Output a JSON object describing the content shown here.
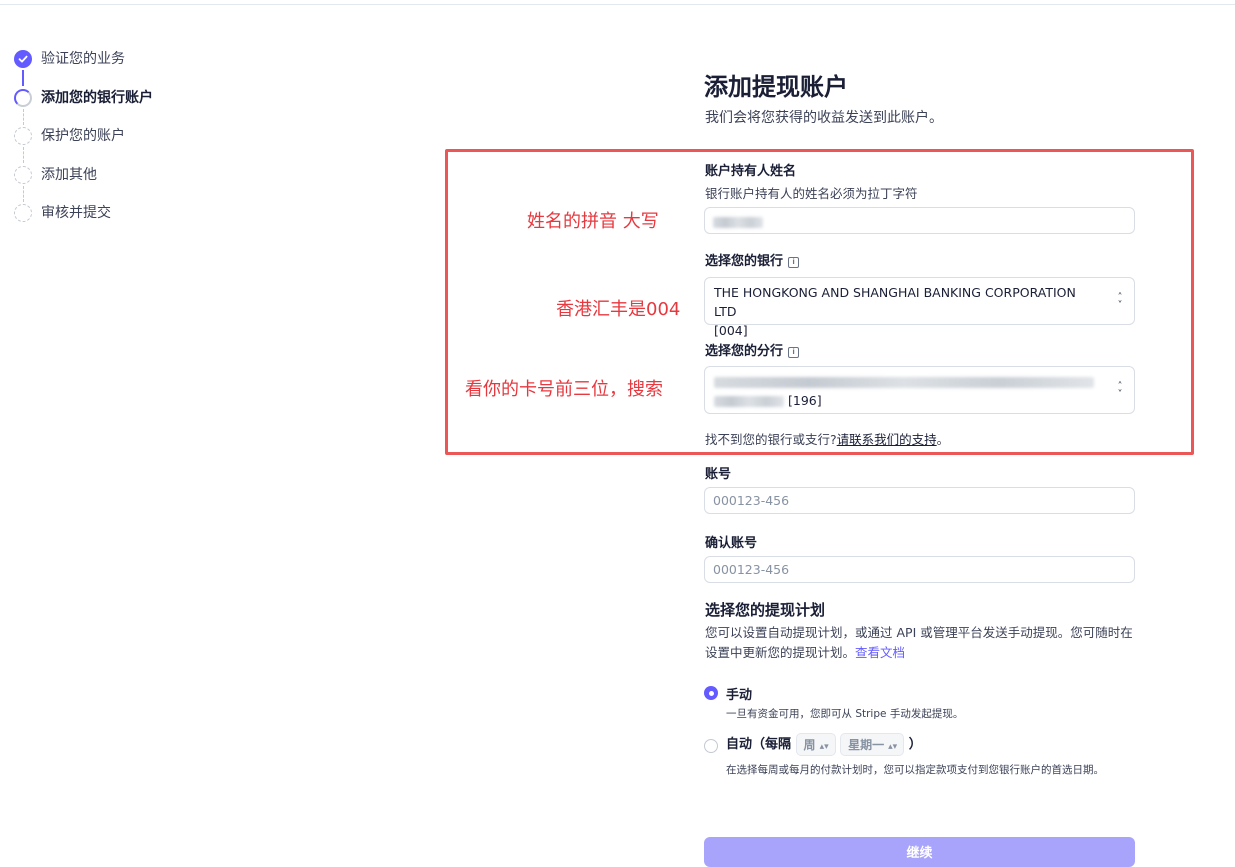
{
  "steps": [
    {
      "label": "验证您的业务",
      "state": "done"
    },
    {
      "label": "添加您的银行账户",
      "state": "current"
    },
    {
      "label": "保护您的账户",
      "state": "todo"
    },
    {
      "label": "添加其他",
      "state": "todo"
    },
    {
      "label": "审核并提交",
      "state": "todo"
    }
  ],
  "form": {
    "title": "添加提现账户",
    "subtitle": "我们会将您获得的收益发送到此账户。",
    "holder_name": {
      "label": "账户持有人姓名",
      "hint": "银行账户持有人的姓名必须为拉丁字符"
    },
    "bank": {
      "label": "选择您的银行",
      "value_line1": "THE HONGKONG AND SHANGHAI BANKING CORPORATION LTD",
      "value_line2": "[004]"
    },
    "branch": {
      "label": "选择您的分行",
      "code": "[196]"
    },
    "help_text": "找不到您的银行或支行?",
    "help_link": "请联系我们的支持",
    "help_end": "。",
    "account_number": {
      "label": "账号",
      "placeholder": "000123-456"
    },
    "confirm_account": {
      "label": "确认账号",
      "placeholder": "000123-456"
    },
    "payout_schedule": {
      "title": "选择您的提现计划",
      "description": "您可以设置自动提现计划，或通过 API 或管理平台发送手动提现。您可随时在设置中更新您的提现计划。",
      "docs_link": "查看文档",
      "manual": {
        "label": "手动",
        "description": "一旦有资金可用，您即可从 Stripe 手动发起提现。",
        "selected": true
      },
      "automatic": {
        "label_prefix": "自动（每隔",
        "interval": "周",
        "day": "星期一",
        "label_suffix": "）",
        "description": "在选择每周或每月的付款计划时，您可以指定款项支付到您银行账户的首选日期。",
        "selected": false
      }
    },
    "continue_label": "继续"
  },
  "annotations": {
    "name_note": "姓名的拼音 大写",
    "bank_note": "香港汇丰是004",
    "branch_note": "看你的卡号前三位，搜索"
  },
  "colors": {
    "accent": "#635bff",
    "annotation": "#eb5757"
  }
}
